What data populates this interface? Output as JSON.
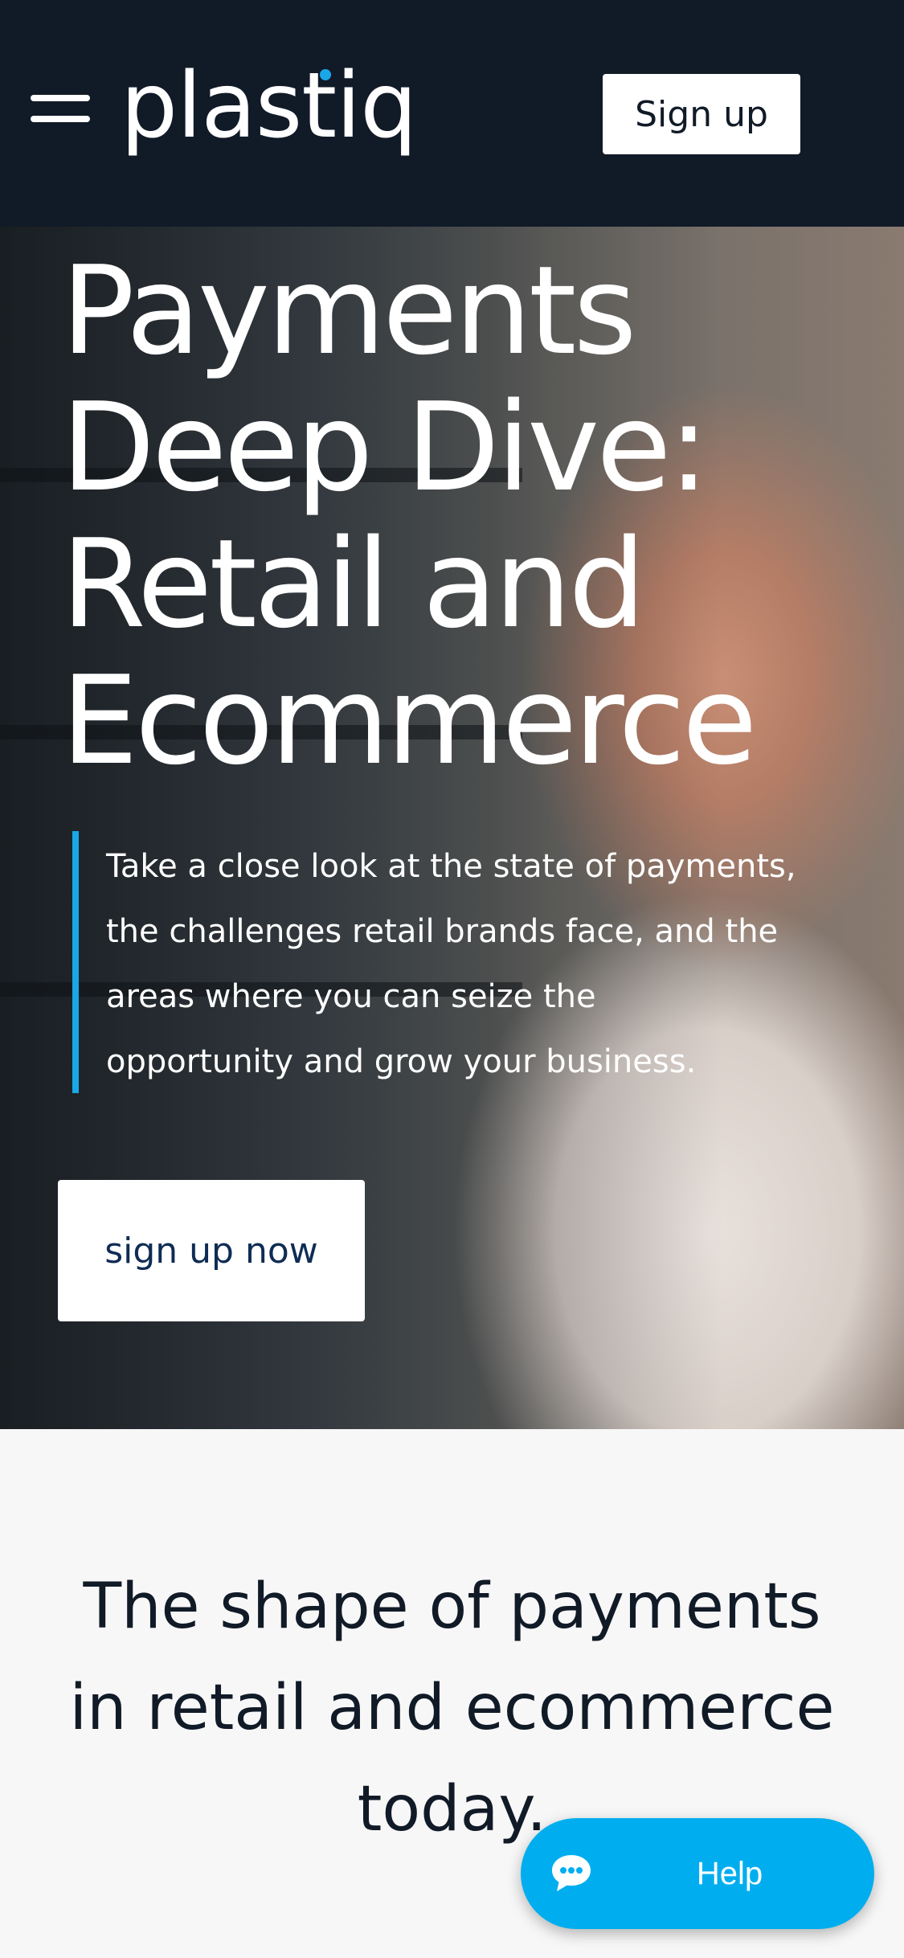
{
  "colors": {
    "header_bg": "#111a27",
    "accent": "#1aa7e8",
    "help_bg": "#00aeef",
    "cta_text": "#0f2c54"
  },
  "header": {
    "menu_icon": "hamburger-menu-icon",
    "logo_text": "plastiq",
    "signup_label": "Sign up"
  },
  "hero": {
    "title_lines": [
      "Payments",
      "Deep Dive:",
      "Retail and",
      "Ecommerce"
    ],
    "description_lines": [
      "Take a close look at the state of payments,",
      "the challenges retail brands face, and the",
      "areas where you can seize the",
      "opportunity and grow your business."
    ],
    "cta_label": "sign up now"
  },
  "section": {
    "title_lines": [
      "The shape of payments",
      "in retail and ecommerce",
      "today."
    ]
  },
  "help": {
    "icon": "chat-bubble-icon",
    "label": "Help"
  }
}
